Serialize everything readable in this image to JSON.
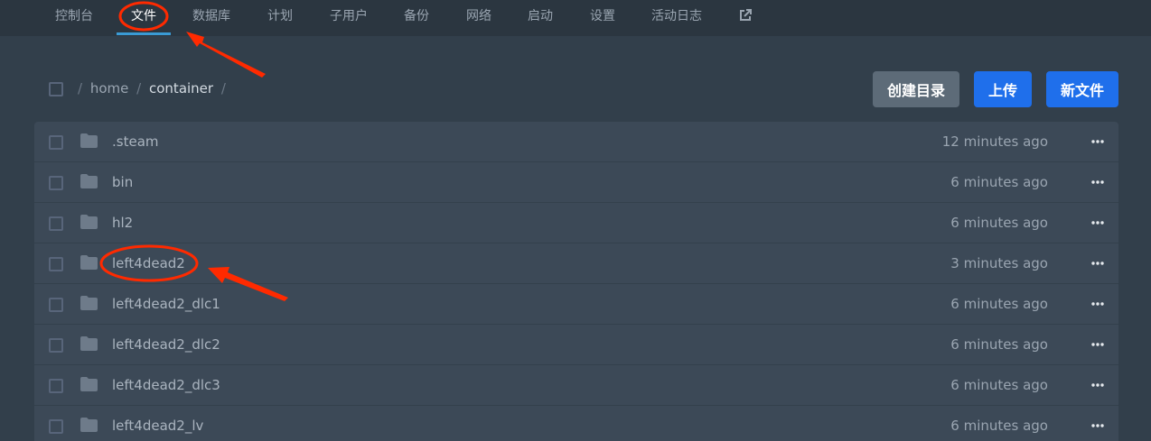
{
  "nav": {
    "items": [
      {
        "label": "控制台"
      },
      {
        "label": "文件"
      },
      {
        "label": "数据库"
      },
      {
        "label": "计划"
      },
      {
        "label": "子用户"
      },
      {
        "label": "备份"
      },
      {
        "label": "网络"
      },
      {
        "label": "启动"
      },
      {
        "label": "设置"
      },
      {
        "label": "活动日志"
      }
    ],
    "active": "文件",
    "external_icon": "external-link-icon"
  },
  "breadcrumb": {
    "separator": "/",
    "parts": [
      "home",
      "container"
    ]
  },
  "actions": {
    "create_dir": "创建目录",
    "upload": "上传",
    "new_file": "新文件"
  },
  "files": [
    {
      "name": ".steam",
      "modified": "12 minutes ago"
    },
    {
      "name": "bin",
      "modified": "6 minutes ago"
    },
    {
      "name": "hl2",
      "modified": "6 minutes ago"
    },
    {
      "name": "left4dead2",
      "modified": "3 minutes ago"
    },
    {
      "name": "left4dead2_dlc1",
      "modified": "6 minutes ago"
    },
    {
      "name": "left4dead2_dlc2",
      "modified": "6 minutes ago"
    },
    {
      "name": "left4dead2_dlc3",
      "modified": "6 minutes ago"
    },
    {
      "name": "left4dead2_lv",
      "modified": "6 minutes ago"
    }
  ],
  "colors": {
    "background": "#323f4b",
    "row": "#3c4957",
    "accent_blue": "#1f6feb",
    "annotation_red": "#ff2a00"
  }
}
